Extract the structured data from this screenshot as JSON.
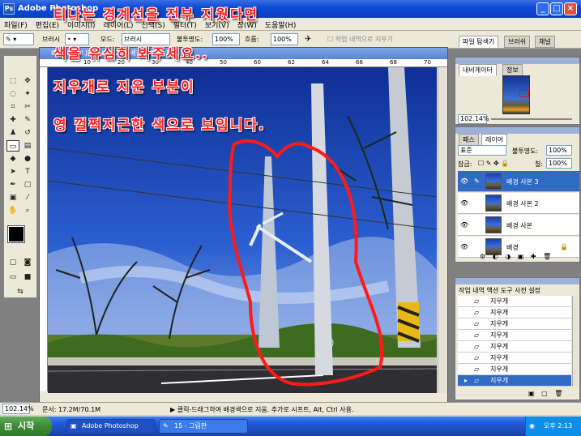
{
  "window": {
    "title": "Adobe Photoshop"
  },
  "menu": [
    "파일(F)",
    "편집(E)",
    "이미지(I)",
    "레이어(L)",
    "선택(S)",
    "필터(T)",
    "보기(V)",
    "창(W)",
    "도움말(H)"
  ],
  "options": {
    "brush_label": "브러시",
    "mode_label": "모드:",
    "mode_value": "브러시",
    "opacity_label": "불투명도:",
    "opacity_value": "100%",
    "flow_label": "흐름:",
    "flow_value": "100%",
    "erase_history": "작업 내역으로 지우기",
    "tab_files": "파일 탐색기",
    "tab_brushes": "브러쉬",
    "tab_channels": "채널"
  },
  "document": {
    "title": "IMG_2370.JPG @ 102% (배경 사본 3, RGB)"
  },
  "ruler_ticks": [
    "",
    "10",
    "20",
    "30",
    "40",
    "50",
    "60",
    "62",
    "64",
    "66",
    "68",
    "70"
  ],
  "captions": {
    "line1": "티나는 경계선을 전부 지웠다면",
    "line2": "색을 유심히 봐주세요..",
    "line3": "지우개로 지운 부분이",
    "line4": "영 껄쩍지근한 색으로 보입니다."
  },
  "navigator": {
    "tab_nav": "내비게이터",
    "tab_info": "정보",
    "zoom": "102.14%"
  },
  "layers": {
    "tab_paths": "패스",
    "tab_layers": "레이어",
    "blend_mode": "표준",
    "opacity_label": "불투명도:",
    "opacity_value": "100%",
    "lock_label": "잠금:",
    "fill_label": "칠:",
    "fill_value": "100%",
    "items": [
      "배경 사본 3",
      "배경 사본 2",
      "배경 사본",
      "배경"
    ]
  },
  "history": {
    "tabs": "작업 내역 액션 도구 사전 설정",
    "items": [
      "지우개",
      "지우개",
      "지우개",
      "지우개",
      "지우개",
      "지우개",
      "지우개",
      "지우개"
    ]
  },
  "status": {
    "zoom": "102.14%",
    "doc_size": "문서: 17.2M/70.1M",
    "hint": "클릭-드래그하여 배경색으로 지움. 추가로 시프트, Alt, Ctrl 사용."
  },
  "taskbar": {
    "start": "시작",
    "task1": "Adobe Photoshop",
    "task2": "15 - 그림판",
    "clock": "오후 2:13"
  },
  "colors": {
    "caption": "#ff2020",
    "taskbar": "#245edb",
    "selection": "#316ac5"
  }
}
